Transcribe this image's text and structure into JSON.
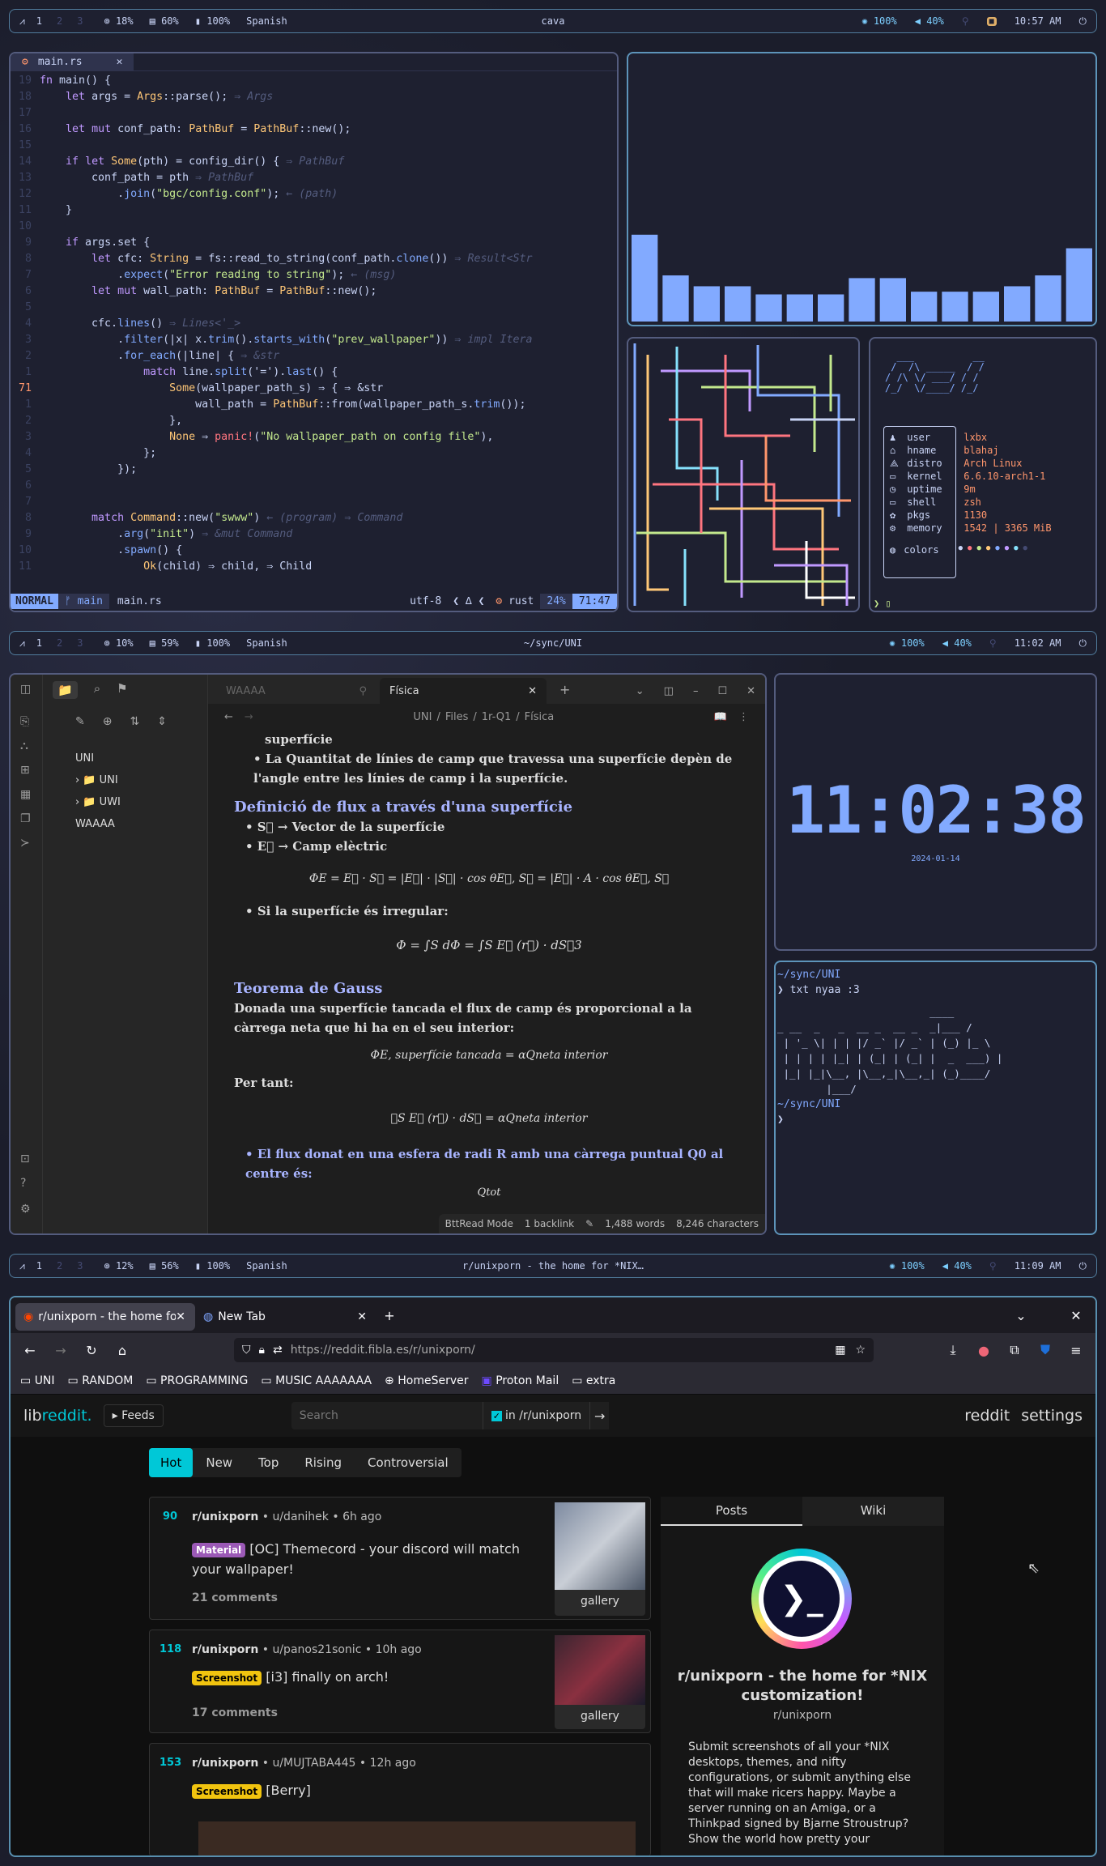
{
  "bars": [
    {
      "ws": [
        "1",
        "2",
        "3"
      ],
      "cpu": "18%",
      "mem": "60%",
      "bat": "100%",
      "lang": "Spanish",
      "title": "cava",
      "bright": "100%",
      "vol": "40%",
      "time": "10:57 AM"
    },
    {
      "ws": [
        "1",
        "2",
        "3"
      ],
      "cpu": "10%",
      "mem": "59%",
      "bat": "100%",
      "lang": "Spanish",
      "title": "~/sync/UNI",
      "bright": "100%",
      "vol": "40%",
      "time": "11:02 AM"
    },
    {
      "ws": [
        "1",
        "2",
        "3"
      ],
      "cpu": "12%",
      "mem": "56%",
      "bat": "100%",
      "lang": "Spanish",
      "title": "r/unixporn - the home for *NIX…",
      "bright": "100%",
      "vol": "40%",
      "time": "11:09 AM"
    }
  ],
  "editor": {
    "tab": "main.rs",
    "mode": "NORMAL",
    "branch": "main",
    "file": "main.rs",
    "enc": "utf-8",
    "lang": "rust",
    "pct": "24%",
    "pos": "71:47",
    "lines": [
      {
        "n": "19",
        "t": "fn main() {"
      },
      {
        "n": "18",
        "t": "    let args = Args::parse(); ⇒ Args"
      },
      {
        "n": "17",
        "t": ""
      },
      {
        "n": "16",
        "t": "    let mut conf_path: PathBuf = PathBuf::new();"
      },
      {
        "n": "15",
        "t": ""
      },
      {
        "n": "14",
        "t": "    if let Some(pth) = config_dir() { ⇒ PathBuf"
      },
      {
        "n": "13",
        "t": "        conf_path = pth ⇒ PathBuf"
      },
      {
        "n": "12",
        "t": "            .join(\"bgc/config.conf\"); ← (path)"
      },
      {
        "n": "11",
        "t": "    }"
      },
      {
        "n": "10",
        "t": ""
      },
      {
        "n": "9",
        "t": "    if args.set {"
      },
      {
        "n": "8",
        "t": "        let cfc: String = fs::read_to_string(conf_path.clone()) ⇒ Result<Str"
      },
      {
        "n": "7",
        "t": "            .expect(\"Error reading to string\"); ← (msg)"
      },
      {
        "n": "6",
        "t": "        let mut wall_path: PathBuf = PathBuf::new();"
      },
      {
        "n": "5",
        "t": ""
      },
      {
        "n": "4",
        "t": "        cfc.lines() ⇒ Lines<'_>"
      },
      {
        "n": "3",
        "t": "            .filter(|x| x.trim().starts_with(\"prev_wallpaper\")) ⇒ impl Itera"
      },
      {
        "n": "2",
        "t": "            .for_each(|line| { ⇒ &str"
      },
      {
        "n": "1",
        "t": "                match line.split('=').last() {"
      },
      {
        "n": "71",
        "t": "                    Some(wallpaper_path_s) ⇒ { ⇒ &str"
      },
      {
        "n": "1",
        "t": "                        wall_path = PathBuf::from(wallpaper_path_s.trim());"
      },
      {
        "n": "2",
        "t": "                    },"
      },
      {
        "n": "3",
        "t": "                    None ⇒ panic!(\"No wallpaper_path on config file\"),"
      },
      {
        "n": "4",
        "t": "                };"
      },
      {
        "n": "5",
        "t": "            });"
      },
      {
        "n": "6",
        "t": ""
      },
      {
        "n": "7",
        "t": ""
      },
      {
        "n": "8",
        "t": "        match Command::new(\"swww\") ← (program) ⇒ Command"
      },
      {
        "n": "9",
        "t": "            .arg(\"init\") ⇒ &mut Command"
      },
      {
        "n": "10",
        "t": "            .spawn() {"
      },
      {
        "n": "11",
        "t": "                Ok(child) ⇒ child, ⇒ Child"
      }
    ]
  },
  "cava": {
    "levels": [
      0.32,
      0.17,
      0.13,
      0.13,
      0.1,
      0.1,
      0.1,
      0.16,
      0.16,
      0.11,
      0.11,
      0.11,
      0.13,
      0.17,
      0.27
    ]
  },
  "fetch": {
    "rows": [
      {
        "k": "user",
        "v": "lxbx"
      },
      {
        "k": "hname",
        "v": "blahaj"
      },
      {
        "k": "distro",
        "v": "Arch Linux"
      },
      {
        "k": "kernel",
        "v": "6.6.10-arch1-1"
      },
      {
        "k": "uptime",
        "v": "9m"
      },
      {
        "k": "shell",
        "v": "zsh"
      },
      {
        "k": "pkgs",
        "v": "1130"
      },
      {
        "k": "memory",
        "v": "1542 | 3365 MiB"
      }
    ],
    "colors_label": "colors",
    "dots": [
      "#c8d3f5",
      "#ff757f",
      "#c3e88d",
      "#ffc777",
      "#82aaff",
      "#c099ff",
      "#86e1fc",
      "#444a73"
    ]
  },
  "obsidian": {
    "tabs": [
      "WAAAA",
      "Física"
    ],
    "breadcrumb": [
      "UNI",
      "Files",
      "1r-Q1",
      "Física"
    ],
    "tree": [
      "UNI",
      "UNI",
      "UWI",
      "WAAAA"
    ],
    "content": {
      "top": "superfície",
      "b1": "La Quantitat de línies de camp que travessa una superfície depèn de l'angle entre les línies de camp i la superfície.",
      "h1": "Definició de flux a través d'una superfície",
      "b2": "→ Vector de la superfície",
      "b3": "→ Camp elèctric",
      "eq1": "ΦE = E⃗ · S⃗ = |E⃗| · |S⃗| · cos θE⃗, S⃗ = |E⃗| · A · cos θE⃗, S⃗",
      "b4": "Si la superfície és irregular:",
      "eq2": "Φ = ∫S dΦ = ∫S E⃗ (r⃗) · dS⃗3",
      "h2": "Teorema de Gauss",
      "p1": "Donada una superfície tancada el flux de camp és proporcional a la càrrega neta que hi ha en el seu interior:",
      "eq3": "ΦE, superfície tancada = αQneta interior",
      "p2": "Per tant:",
      "eq4": "∮S E⃗ (r⃗) · dS⃗ = αQneta interior",
      "b5": "El flux donat en una esfera de radi R amb una càrrega puntual Q0 al centre és:",
      "eq5": "Qtot"
    },
    "status": {
      "mode": "BttRead Mode",
      "backlinks": "1 backlink",
      "words": "1,488 words",
      "chars": "8,246 characters"
    }
  },
  "clock": {
    "time": "11:02:38",
    "date": "2024-01-14"
  },
  "term": {
    "lines": [
      "~/sync/UNI",
      "❯ txt nyaa :3"
    ],
    "ascii": [
      "                         ____",
      "_ __  _   _  __ _  __ _  _|___ /",
      " | '_ \\| | | |/ _` |/ _` | (_) |_ \\",
      " | | | | |_| | (_| | (_| |  _  ___) |",
      " |_| |_|\\__, |\\__,_|\\__,_| (_)____/ ",
      "        |___/"
    ],
    "cwd2": "~/sync/UNI"
  },
  "browser": {
    "tabs": [
      "r/unixporn - the home for",
      "New Tab"
    ],
    "url": "https://reddit.fibla.es/r/unixporn/",
    "bookmarks": [
      "UNI",
      "RANDOM",
      "PROGRAMMING",
      "MUSIC AAAAAAA",
      "HomeServer",
      "Proton Mail",
      "extra"
    ],
    "brand_a": "lib",
    "brand_b": "reddit.",
    "feeds": "Feeds",
    "search_placeholder": "Search",
    "in_sub": "in /r/unixporn",
    "nav_right": [
      "reddit",
      "settings"
    ],
    "sort": [
      "Hot",
      "New",
      "Top",
      "Rising",
      "Controversial"
    ],
    "posts": [
      {
        "score": "90",
        "sub": "r/unixporn",
        "user": "u/danihek",
        "age": "6h ago",
        "flair": "Material",
        "flair_color": "#9b59b6",
        "title": "[OC] Themecord - your discord will match your wallpaper!",
        "comments": "21 comments",
        "thumb": "gallery"
      },
      {
        "score": "118",
        "sub": "r/unixporn",
        "user": "u/panos21sonic",
        "age": "10h ago",
        "flair": "Screenshot",
        "flair_color": "#f1c40f",
        "title": "[i3] finally on arch!",
        "comments": "17 comments",
        "thumb": "gallery"
      },
      {
        "score": "153",
        "sub": "r/unixporn",
        "user": "u/MUJTABA445",
        "age": "12h ago",
        "flair": "Screenshot",
        "flair_color": "#f1c40f",
        "title": "[Berry]",
        "comments": "",
        "thumb": ""
      }
    ],
    "sidebar": {
      "tabs": [
        "Posts",
        "Wiki"
      ],
      "title": "r/unixporn - the home for *NIX customization!",
      "name": "r/unixporn",
      "desc": "Submit screenshots of all your *NIX desktops, themes, and nifty configurations, or submit anything else that will make ricers happy. Maybe a server running on an Amiga, or a Thinkpad signed by Bjarne Stroustrup? Show the world how pretty your"
    }
  }
}
